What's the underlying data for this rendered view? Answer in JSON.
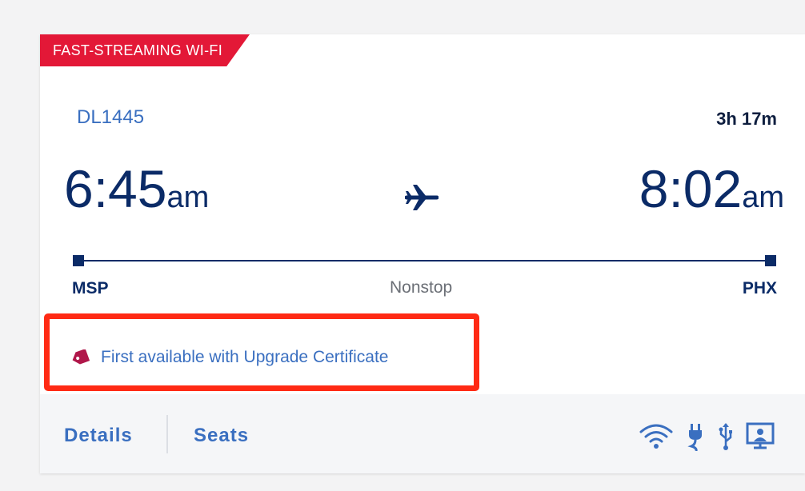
{
  "banner": {
    "label": "FAST-STREAMING WI-FI"
  },
  "flight": {
    "number": "DL1445",
    "duration": "3h 17m",
    "departure": {
      "time": "6:45",
      "ampm": "am",
      "code": "MSP"
    },
    "arrival": {
      "time": "8:02",
      "ampm": "am",
      "code": "PHX"
    },
    "stops": "Nonstop"
  },
  "upgrade": {
    "text": "First available with Upgrade Certificate",
    "icon": "tag-icon"
  },
  "footer": {
    "details_label": "Details",
    "seats_label": "Seats",
    "amenities": [
      "wifi-icon",
      "power-icon",
      "usb-icon",
      "screen-icon"
    ]
  },
  "colors": {
    "brand_red": "#e31837",
    "navy": "#0b2b67",
    "link_blue": "#3a6fc0",
    "tag_magenta": "#b0174a",
    "highlight_red": "#ff2a14"
  }
}
